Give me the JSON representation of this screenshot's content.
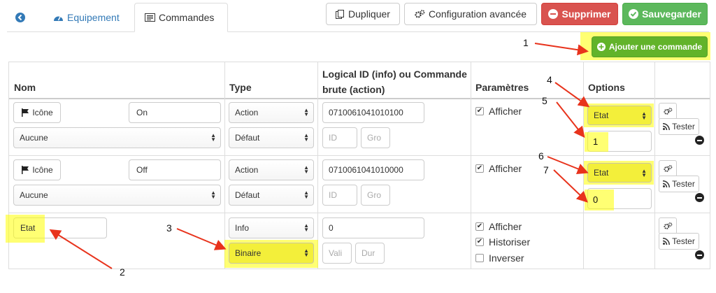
{
  "tabs": {
    "home_icon": "arrow-circle-left-icon",
    "equipement": "Equipement",
    "commandes": "Commandes"
  },
  "actions": {
    "duplicate": "Dupliquer",
    "config": "Configuration avancée",
    "delete": "Supprimer",
    "save": "Sauvegarder",
    "add_command": "Ajouter une commande"
  },
  "table": {
    "headers": {
      "nom": "Nom",
      "type": "Type",
      "logical_id": "Logical ID (info) ou Commande brute (action)",
      "parametres": "Paramètres",
      "options": "Options"
    },
    "rows": [
      {
        "icon_label": "Icône",
        "name": "On",
        "subtype_select": "Aucune",
        "type": "Action",
        "subtype": "Défaut",
        "logical_id": "0710061041010100",
        "id_placeholder": "ID",
        "gro_placeholder": "Gro",
        "param_afficher": "Afficher",
        "option_select": "Etat",
        "option_value": "1",
        "tester": "Tester"
      },
      {
        "icon_label": "Icône",
        "name": "Off",
        "subtype_select": "Aucune",
        "type": "Action",
        "subtype": "Défaut",
        "logical_id": "0710061041010000",
        "id_placeholder": "ID",
        "gro_placeholder": "Gro",
        "param_afficher": "Afficher",
        "option_select": "Etat",
        "option_value": "0",
        "tester": "Tester"
      },
      {
        "name": "Etat",
        "type": "Info",
        "subtype": "Binaire",
        "logical_id": "0",
        "val_placeholder": "Vali",
        "dur_placeholder": "Dur",
        "param_afficher": "Afficher",
        "param_historiser": "Historiser",
        "param_inverser": "Inverser",
        "tester": "Tester"
      }
    ]
  },
  "annotations": {
    "n1": "1",
    "n2": "2",
    "n3": "3",
    "n4": "4",
    "n5": "5",
    "n6": "6",
    "n7": "7"
  },
  "colors": {
    "red": "#d9534f",
    "green": "#5cb85c",
    "add_green": "#62b32a",
    "highlight": "#ffff00",
    "arrow": "#e8331c"
  }
}
